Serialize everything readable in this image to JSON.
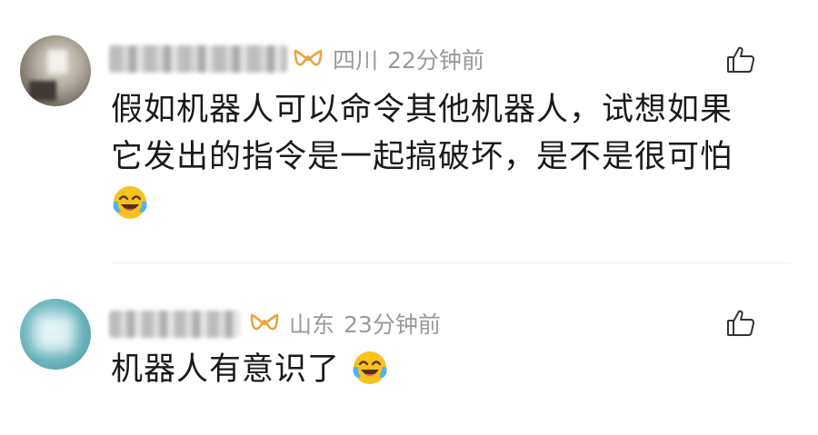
{
  "comments": [
    {
      "location": "四川",
      "time": "22分钟前",
      "text_lines": [
        "假如机器人可以命令其他机器人，试想如果",
        "它发出的指令是一起搞破坏，是不是很可怕"
      ],
      "trailing_emoji": "laugh-cry-emoji"
    },
    {
      "location": "山东",
      "time": "23分钟前",
      "text_lines": [
        "机器人有意识了"
      ],
      "trailing_emoji": "laugh-cry-emoji"
    }
  ],
  "colors": {
    "badge_gold": "#e7a53e",
    "meta_gray": "#9a9a9a",
    "text": "#1a1a1a",
    "divider": "#ececec"
  }
}
